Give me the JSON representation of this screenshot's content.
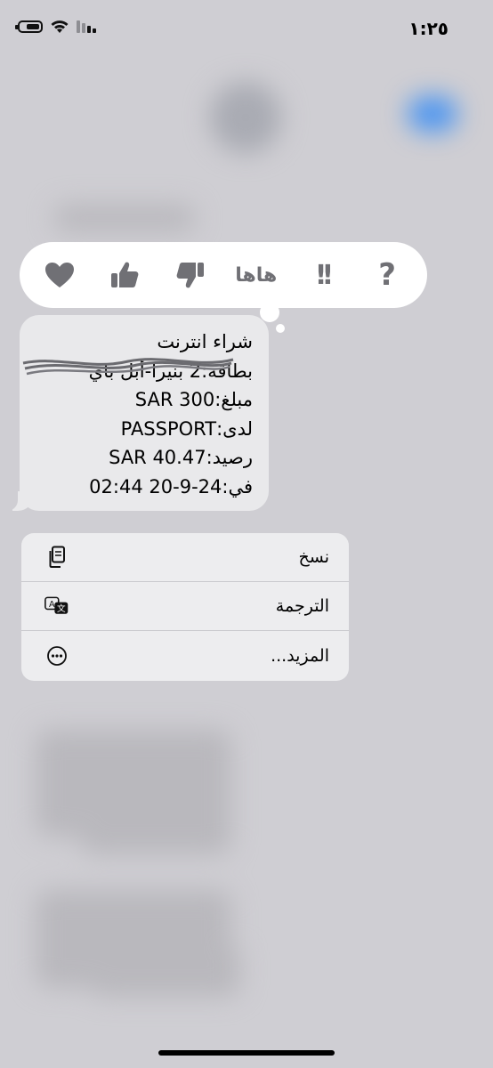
{
  "status_bar": {
    "time": "١:٢٥"
  },
  "reactions": [
    {
      "icon": "heart-icon"
    },
    {
      "icon": "thumbs-up-icon"
    },
    {
      "icon": "thumbs-down-icon"
    },
    {
      "icon": "haha-icon",
      "label": "هاها"
    },
    {
      "icon": "exclamation-icon",
      "label": "!!"
    },
    {
      "icon": "question-icon",
      "label": "?"
    }
  ],
  "message": {
    "lines": [
      "شراء انترنت",
      "بطاقة:2 بنيرا-أبل باي",
      "مبلغ:SAR 300",
      "لدى:PASSPORT",
      "رصيد:SAR 40.47",
      "في:24-9-20 02:44"
    ]
  },
  "menu": {
    "items": [
      {
        "label": "نسخ",
        "icon": "copy-icon"
      },
      {
        "label": "الترجمة",
        "icon": "translate-icon"
      },
      {
        "label": "المزيد...",
        "icon": "more-icon"
      }
    ]
  },
  "colors": {
    "background": "#cfced3",
    "bubble": "#e9e9eb",
    "menu": "#ededef",
    "reaction_icon": "#707075"
  }
}
